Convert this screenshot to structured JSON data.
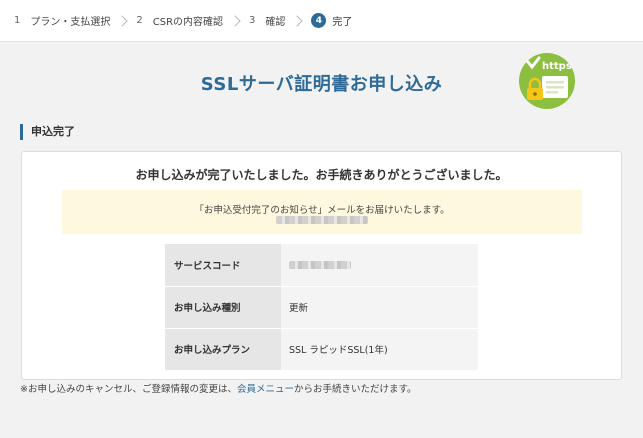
{
  "steps": [
    {
      "num": "1",
      "label": "プラン・支払選択"
    },
    {
      "num": "2",
      "label": "CSRの内容確認"
    },
    {
      "num": "3",
      "label": "確認"
    },
    {
      "num": "4",
      "label": "完了"
    }
  ],
  "page": {
    "title": "SSLサーバ証明書お申し込み",
    "badge_text": "https",
    "section_title": "申込完了"
  },
  "card": {
    "heading": "お申し込みが完了いたしました。お手続きありがとうございました。",
    "notice": "「お申込受付完了のお知らせ」メールをお届けいたします。"
  },
  "details": {
    "service_code_label": "サービスコード",
    "type_label": "お申し込み種別",
    "type_value": "更新",
    "plan_label": "お申し込みプラン",
    "plan_value": "SSL ラピッドSSL(1年)"
  },
  "footnote": {
    "prefix": "※お申し込みのキャンセル、ご登録情報の変更は、",
    "link": "会員メニュー",
    "suffix": "からお手続きいただけます。"
  },
  "colors": {
    "accent": "#2d6a98",
    "badge": "#8cbf3f",
    "notice_bg": "#fdf8de"
  }
}
